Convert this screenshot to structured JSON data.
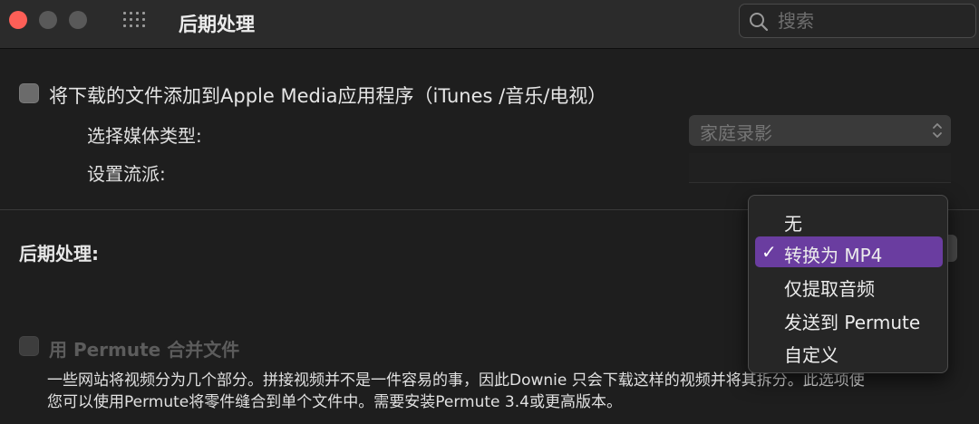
{
  "titlebar": {
    "title": "后期处理",
    "search_placeholder": "搜索"
  },
  "colors": {
    "accent_selected": "#6a3da0",
    "close_button": "#fe5f57"
  },
  "apple_media": {
    "checkbox_label": "将下载的文件添加到Apple Media应用程序（iTunes /音乐/电视）",
    "checked": false,
    "media_type_label": "选择媒体类型:",
    "media_type_value": "家庭录影",
    "genre_label": "设置流派:",
    "genre_value": ""
  },
  "post_processing": {
    "label": "后期处理:",
    "menu": {
      "items": [
        "无",
        "转换为 MP4",
        "仅提取音频",
        "发送到 Permute",
        "自定义"
      ],
      "selected_index": 1,
      "check_glyph": "✓"
    }
  },
  "permute": {
    "checkbox_label": "用 Permute 合并文件",
    "checked": false,
    "enabled": false,
    "description_line1": "一些网站将视频分为几个部分。拼接视频并不是一件容易的事，因此Downie 只会下载这样的视频并将其拆分。此选项使",
    "description_line2": "您可以使用Permute将零件缝合到单个文件中。需要安装Permute 3.4或更高版本。"
  }
}
